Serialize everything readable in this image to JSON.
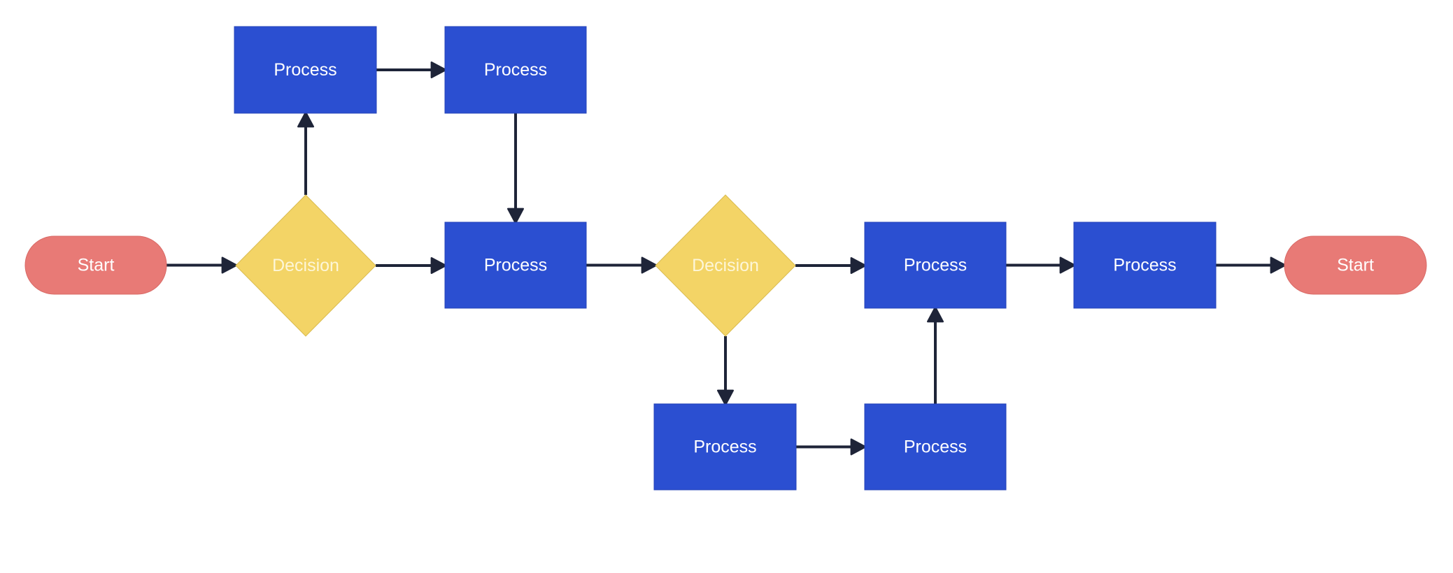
{
  "colors": {
    "process": "#2b4fd1",
    "decision": "#f3d466",
    "terminal": "#e87a76",
    "arrow": "#1e2438",
    "background": "#ffffff"
  },
  "nodes": [
    {
      "id": "start",
      "type": "terminal",
      "label": "Start"
    },
    {
      "id": "decision1",
      "type": "decision",
      "label": "Decision"
    },
    {
      "id": "process_top1",
      "type": "process",
      "label": "Process"
    },
    {
      "id": "process_top2",
      "type": "process",
      "label": "Process"
    },
    {
      "id": "process_mid1",
      "type": "process",
      "label": "Process"
    },
    {
      "id": "decision2",
      "type": "decision",
      "label": "Decision"
    },
    {
      "id": "process_mid2",
      "type": "process",
      "label": "Process"
    },
    {
      "id": "process_mid3",
      "type": "process",
      "label": "Process"
    },
    {
      "id": "end",
      "type": "terminal",
      "label": "Start"
    },
    {
      "id": "process_bot1",
      "type": "process",
      "label": "Process"
    },
    {
      "id": "process_bot2",
      "type": "process",
      "label": "Process"
    }
  ],
  "edges": [
    [
      "start",
      "decision1"
    ],
    [
      "decision1",
      "process_top1"
    ],
    [
      "process_top1",
      "process_top2"
    ],
    [
      "process_top2",
      "process_mid1"
    ],
    [
      "decision1",
      "process_mid1"
    ],
    [
      "process_mid1",
      "decision2"
    ],
    [
      "decision2",
      "process_mid2"
    ],
    [
      "decision2",
      "process_bot1"
    ],
    [
      "process_bot1",
      "process_bot2"
    ],
    [
      "process_bot2",
      "process_mid2"
    ],
    [
      "process_mid2",
      "process_mid3"
    ],
    [
      "process_mid3",
      "end"
    ]
  ]
}
